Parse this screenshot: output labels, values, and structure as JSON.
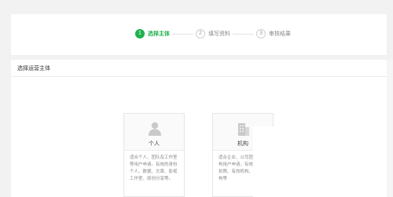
{
  "steps": [
    {
      "num": "1",
      "label": "选择主体"
    },
    {
      "num": "2",
      "label": "填写资料"
    },
    {
      "num": "3",
      "label": "审核结果"
    }
  ],
  "panel": {
    "title": "选择运营主体"
  },
  "cards": [
    {
      "name": "个人",
      "icon": "person-icon",
      "desc": "适合个人、团队及工作室等用户申请。有效的身份个人、数据、文章、影视工作室、原创分享等。"
    },
    {
      "name": "机构",
      "icon": "building-icon",
      "desc": "适合企业、公司团队等机构用户申请，有效的营业执照、有效机构、政府机构等"
    }
  ],
  "colors": {
    "accent": "#1fb14e",
    "background": "#f2f2f2"
  }
}
